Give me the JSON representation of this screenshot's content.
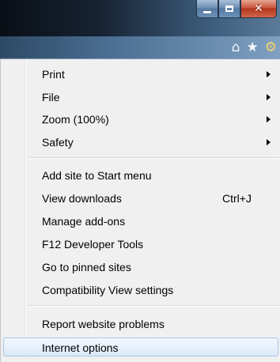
{
  "toolbar": {
    "icons": [
      "home-icon",
      "favorites-star-icon",
      "tools-gear-icon"
    ]
  },
  "window_controls": [
    "minimize",
    "maximize",
    "close"
  ],
  "menu": {
    "group1": [
      {
        "label": "Print",
        "submenu": true
      },
      {
        "label": "File",
        "submenu": true
      },
      {
        "label": "Zoom (100%)",
        "submenu": true
      },
      {
        "label": "Safety",
        "submenu": true
      }
    ],
    "group2": [
      {
        "label": "Add site to Start menu"
      },
      {
        "label": "View downloads",
        "shortcut": "Ctrl+J"
      },
      {
        "label": "Manage add-ons"
      },
      {
        "label": "F12 Developer Tools"
      },
      {
        "label": "Go to pinned sites"
      },
      {
        "label": "Compatibility View settings"
      }
    ],
    "group3": [
      {
        "label": "Report website problems"
      },
      {
        "label": "Internet options",
        "highlighted": true
      }
    ]
  }
}
